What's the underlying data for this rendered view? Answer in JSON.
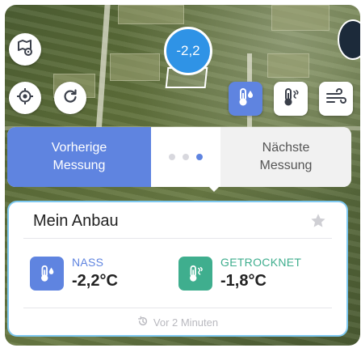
{
  "map": {
    "marker_value": "-2,2"
  },
  "toolbar": {
    "field_settings_icon": "map-gear-icon",
    "locate_icon": "crosshair-icon",
    "refresh_icon": "refresh-icon",
    "wet_temp_icon": "thermometer-drop-icon",
    "dry_temp_icon": "thermometer-wind-icon",
    "wind_icon": "wind-icon"
  },
  "navigation": {
    "previous_label": "Vorherige Messung",
    "next_label": "Nächste Messung",
    "pager": {
      "count": 3,
      "active_index": 2
    }
  },
  "card": {
    "title": "Mein Anbau",
    "favorite_icon": "star-icon",
    "readings": [
      {
        "label": "NASS",
        "value": "-2,2°C",
        "color": "#5f84e0",
        "icon": "thermometer-drop-icon"
      },
      {
        "label": "GETROCKNET",
        "value": "-1,8°C",
        "color": "#3fae8e",
        "icon": "thermometer-wind-icon"
      }
    ],
    "updated": "Vor 2 Minuten",
    "updated_icon": "history-icon"
  },
  "colors": {
    "accent": "#5f84e0",
    "marker": "#2f93e6",
    "dry": "#3fae8e",
    "card_border": "#7ec8f0"
  }
}
